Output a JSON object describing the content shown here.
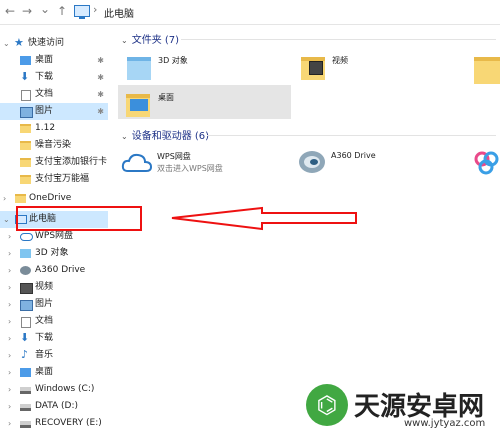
{
  "address": {
    "location": "此电脑"
  },
  "nav_icons": {
    "back": "←",
    "forward": "→",
    "dropdown": "⌄",
    "up": "↑",
    "separator": "›"
  },
  "sidebar": {
    "quick_access": "快速访问",
    "quick_items": [
      {
        "label": "桌面",
        "icon": "desktop-icon",
        "pinned": true
      },
      {
        "label": "下载",
        "icon": "download-icon",
        "pinned": true
      },
      {
        "label": "文档",
        "icon": "documents-icon",
        "pinned": true
      },
      {
        "label": "图片",
        "icon": "pictures-icon",
        "pinned": true
      },
      {
        "label": "1.12",
        "icon": "folder-icon",
        "pinned": false
      },
      {
        "label": "噪音污染",
        "icon": "folder-icon",
        "pinned": false
      },
      {
        "label": "支付宝添加银行卡",
        "icon": "folder-icon",
        "pinned": false
      },
      {
        "label": "支付宝万能福",
        "icon": "folder-icon",
        "pinned": false
      }
    ],
    "onedrive": "OneDrive",
    "this_pc": "此电脑",
    "pc_items": [
      {
        "label": "WPS网盘",
        "icon": "cloud-icon"
      },
      {
        "label": "3D 对象",
        "icon": "3d-objects-icon"
      },
      {
        "label": "A360 Drive",
        "icon": "a360-icon"
      },
      {
        "label": "视频",
        "icon": "videos-icon"
      },
      {
        "label": "图片",
        "icon": "pictures-icon"
      },
      {
        "label": "文档",
        "icon": "documents-icon"
      },
      {
        "label": "下载",
        "icon": "download-icon"
      },
      {
        "label": "音乐",
        "icon": "music-icon"
      },
      {
        "label": "桌面",
        "icon": "desktop-icon"
      },
      {
        "label": "Windows (C:)",
        "icon": "drive-icon"
      },
      {
        "label": "DATA (D:)",
        "icon": "drive-icon"
      },
      {
        "label": "RECOVERY (E:)",
        "icon": "drive-icon"
      }
    ]
  },
  "main": {
    "folders_header": "文件夹 (7)",
    "folders": [
      {
        "label": "3D 对象"
      },
      {
        "label": "视频"
      },
      {
        "label": "桌面"
      }
    ],
    "devices_header": "设备和驱动器 (6)",
    "devices": [
      {
        "name": "WPS网盘",
        "sub": "双击进入WPS网盘"
      },
      {
        "name": "A360 Drive",
        "sub": ""
      }
    ]
  },
  "watermark": {
    "brand": "天源安卓网",
    "url": "www.jytyaz.com"
  },
  "colors": {
    "annotation": "#ee1111",
    "selection": "#cde8ff",
    "accent": "#2b78c5"
  }
}
